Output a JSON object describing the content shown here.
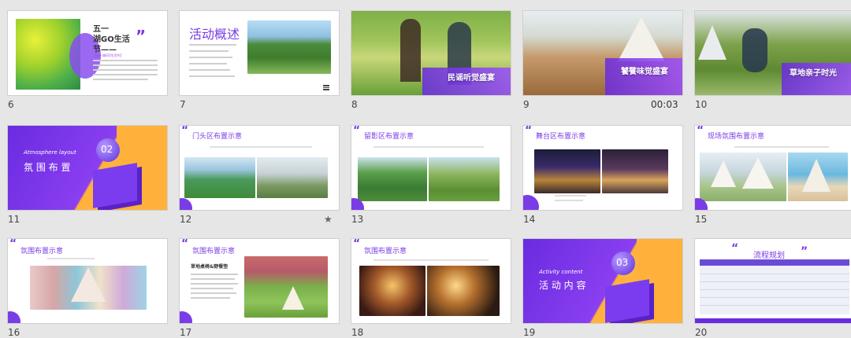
{
  "slides": [
    {
      "num": "6",
      "title": "五一",
      "title2": "湖GO生活",
      "title3": "节——",
      "body": "【五一湖GO生活节】"
    },
    {
      "num": "7",
      "title": "活动概述"
    },
    {
      "num": "8",
      "caption": "民谣听觉盛宴"
    },
    {
      "num": "9",
      "caption": "饕餮味觉盛宴",
      "duration": "00:03"
    },
    {
      "num": "10",
      "caption": "草地亲子时光"
    },
    {
      "num": "11",
      "badge": "02",
      "en": "Atmosphere layout",
      "zh": "氛 围 布 置"
    },
    {
      "num": "12",
      "title": "门头区布置示意",
      "star": "★"
    },
    {
      "num": "13",
      "title": "留影区布置示意"
    },
    {
      "num": "14",
      "title": "舞台区布置示意"
    },
    {
      "num": "15",
      "title": "现场氛围布置示意"
    },
    {
      "num": "16",
      "title": "氛围布置示意"
    },
    {
      "num": "17",
      "title": "氛围布置示意",
      "sub": "草地桌椅&野餐垫"
    },
    {
      "num": "18",
      "title": "氛围布置示意"
    },
    {
      "num": "19",
      "badge": "03",
      "en": "Activity content",
      "zh": "活 动 内 容"
    },
    {
      "num": "20",
      "title": "流程规划"
    }
  ],
  "colors": {
    "accent": "#7a3ce6",
    "orange": "#ffb13b",
    "bg": "#e6e6e6"
  }
}
